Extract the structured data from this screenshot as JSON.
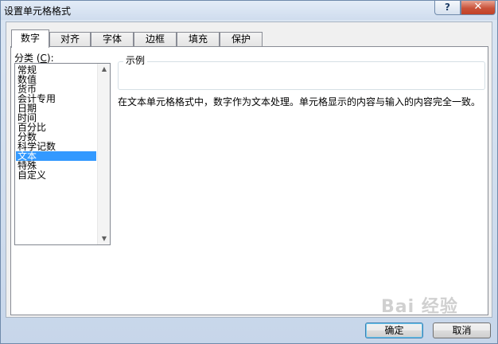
{
  "window": {
    "title": "设置单元格格式",
    "help_label": "?",
    "close_label": "✕"
  },
  "tabs": [
    {
      "label": "数字",
      "active": true
    },
    {
      "label": "对齐",
      "active": false
    },
    {
      "label": "字体",
      "active": false
    },
    {
      "label": "边框",
      "active": false
    },
    {
      "label": "填充",
      "active": false
    },
    {
      "label": "保护",
      "active": false
    }
  ],
  "category": {
    "label_prefix": "分类 (",
    "accel": "C",
    "label_suffix": "):",
    "items": [
      "常规",
      "数值",
      "货币",
      "会计专用",
      "日期",
      "时间",
      "百分比",
      "分数",
      "科学记数",
      "文本",
      "特殊",
      "自定义"
    ],
    "selected": "文本",
    "scroll_up": "▲",
    "scroll_down": "▼"
  },
  "sample": {
    "label": "示例",
    "value": ""
  },
  "description": "在文本单元格格式中，数字作为文本处理。单元格显示的内容与输入的内容完全一致。",
  "buttons": {
    "ok": "确定",
    "cancel": "取消"
  },
  "watermark": "Bai 经验"
}
